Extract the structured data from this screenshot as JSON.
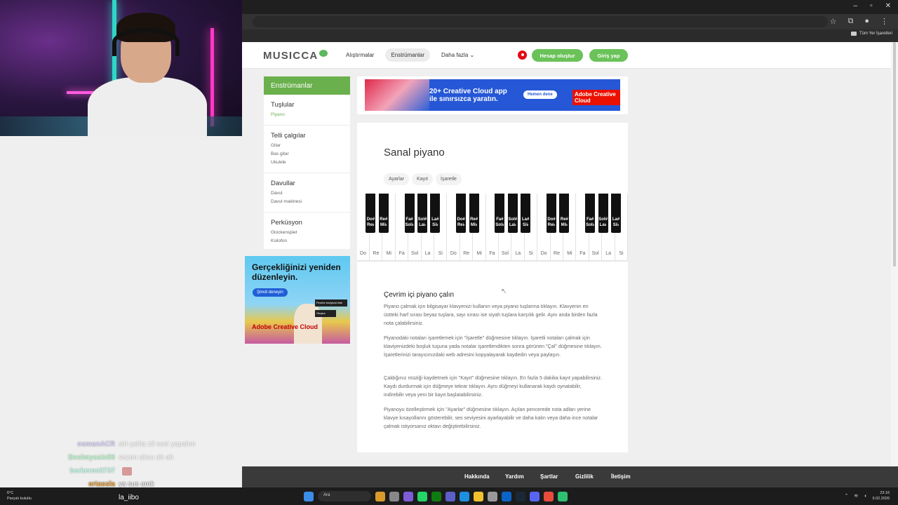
{
  "browser": {
    "bookmarks_label": "Tüm Yer İşaretleri"
  },
  "site": {
    "logo": "MUSICCA",
    "nav": [
      "Alıştırmalar",
      "Enstrümanlar",
      "Daha fazla ⌄"
    ],
    "create_account": "Hesap oluştur",
    "login": "Giriş yap"
  },
  "sidebar": {
    "title": "Enstrümanlar",
    "groups": [
      {
        "head": "Tuşlular",
        "items": [
          "Piyano"
        ]
      },
      {
        "head": "Telli çalgılar",
        "items": [
          "Gitar",
          "Bas gitar",
          "Ukulele"
        ]
      },
      {
        "head": "Davullar",
        "items": [
          "Davul",
          "Davul makinesi"
        ]
      },
      {
        "head": "Perküsyon",
        "items": [
          "Glockenspiel",
          "Ksilofon"
        ]
      }
    ]
  },
  "ads": {
    "top_headline": "20+ Creative Cloud app ile sınırsızca yaratın.",
    "top_cta": "Hemen dene",
    "top_brand": "Adobe Creative Cloud",
    "side_headline": "Gerçekliğinizi yeniden düzenleyin.",
    "side_cta": "Şimdi deneyin",
    "side_mini1": "Pembe bodysuit ekle",
    "side_mini2": "Oluştur",
    "side_brand": "Adobe Creative Cloud"
  },
  "main": {
    "title": "Sanal piyano",
    "tabs": [
      "Ayarlar",
      "Kayıt",
      "İşaretle"
    ],
    "white_keys": [
      "Do",
      "Re",
      "Mi",
      "Fa",
      "Sol",
      "La",
      "Si",
      "Do",
      "Re",
      "Mi",
      "Fa",
      "Sol",
      "La",
      "Si",
      "Do",
      "Re",
      "Mi",
      "Fa",
      "Sol",
      "La",
      "Si"
    ],
    "black_keys": [
      "Do#\nRe♭",
      "Re#\nMi♭",
      "Fa#\nSol♭",
      "Sol#\nLa♭",
      "La#\nSi♭",
      "Do#\nRe♭",
      "Re#\nMi♭",
      "Fa#\nSol♭",
      "Sol#\nLa♭",
      "La#\nSi♭",
      "Do#\nRe♭",
      "Re#\nMi♭",
      "Fa#\nSol♭",
      "Sol#\nLa♭",
      "La#\nSi♭"
    ],
    "content_heading": "Çevrim içi piyano çalın",
    "paragraphs": [
      "Piyano çalmak için bilgisayar klavyenizi kullanın veya piyano tuşlarına tıklayın. Klavyenin en üstteki harf sırası beyaz tuşlara, sayı sırası ise siyah tuşlara karşılık gelir. Aynı anda birden fazla nota çalabilirsiniz.",
      "Piyanodaki notaları işaretlemek için \"İşaretle\" düğmesine tıklayın. İşaretli notaları çalmak için klaviyenizdeki boşluk tuşuna yada notalar işaretlendikten sonra görünen \"Çal\" düğmesine tıklayın. İşaretlerinizi tarayıcınızdaki web adresini kopyalayarak kaydedin veya paylaşın.",
      "Çaldığınız müziği kaydetmek için \"Kayıt\" düğmesine tıklayın. En fazla 5 dakika kayıt yapabilirsiniz. Kaydı durdurmak için düğmeye tekrar tıklayın. Aynı düğmeyi kullanarak kaydı oynatabilir, indirebilir veya yeni bir kayıt başlatabilirsiniz.",
      "Piyanoyu özelleştirmek için \"Ayarlar\" düğmesine tıklayın. Açılan pencerede nota adları yerine klavye kısayollarını gösterebilir, ses seviyesini ayarlayabilir ve daha kalın veya daha ince notalar çalmak istiyorsanız oktavı değiştirebilirsiniz."
    ]
  },
  "footer": {
    "links": [
      "Hakkında",
      "Yardım",
      "Şartlar",
      "Gizlilik",
      "İletişim"
    ]
  },
  "chat": [
    {
      "user": "osmanACR",
      "color": "#b9a3ff",
      "msg": "siri çalıla zil sesi yapalım",
      "faded": true
    },
    {
      "user": "Beslmyasin56",
      "color": "#7cff9e",
      "msg": "sezen aksu ah ah",
      "faded": true
    },
    {
      "user": "berkeren3737",
      "color": "#7cffd8",
      "msg": "",
      "faded": true
    },
    {
      "user": "ertassla",
      "color": "#ffb347",
      "msg": "ya sus amk",
      "faded": false
    },
    {
      "user": "",
      "color": "#ffffff",
      "msg": "la_iibo",
      "faded": false
    }
  ],
  "taskbar": {
    "weather_temp": "6°C",
    "weather_desc": "Parçalı bulutlu",
    "search_placeholder": "Ara",
    "time": "23:16",
    "date": "9.02.2026"
  }
}
